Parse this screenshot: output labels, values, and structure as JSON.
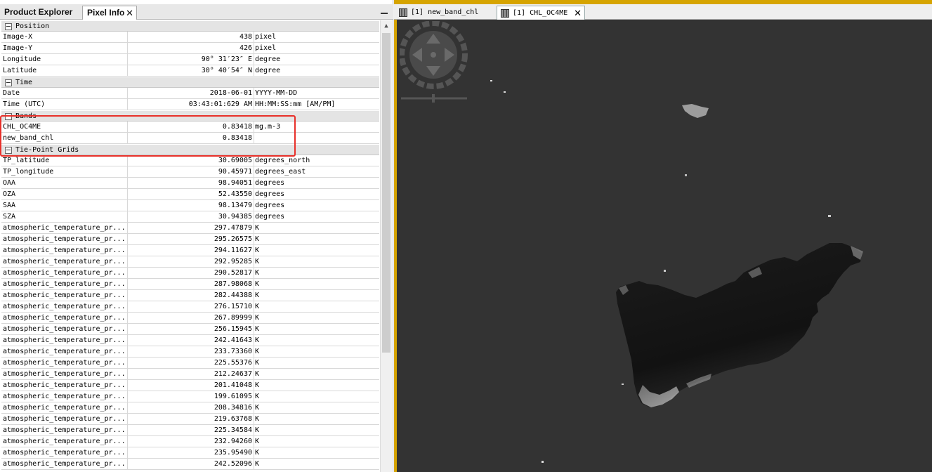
{
  "left_tabs": {
    "product_explorer": "Product Explorer",
    "pixel_info": "Pixel Info",
    "close_glyph": "✕"
  },
  "sections": [
    {
      "title": "Position",
      "rows": [
        [
          "Image-X",
          "438",
          "pixel"
        ],
        [
          "Image-Y",
          "426",
          "pixel"
        ],
        [
          "Longitude",
          "90° 31′23″ E",
          "degree"
        ],
        [
          "Latitude",
          "30° 40′54″ N",
          "degree"
        ]
      ]
    },
    {
      "title": "Time",
      "rows": [
        [
          "Date",
          "2018-06-01",
          "YYYY-MM-DD"
        ],
        [
          "Time (UTC)",
          "03:43:01:629 AM",
          "HH:MM:SS:mm [AM/PM]"
        ]
      ]
    },
    {
      "title": "Bands",
      "rows": [
        [
          "CHL_OC4ME",
          "0.83418",
          "mg.m-3"
        ],
        [
          "new_band_chl",
          "0.83418",
          ""
        ]
      ]
    },
    {
      "title": "Tie-Point Grids",
      "rows": [
        [
          "TP_latitude",
          "30.69005",
          "degrees_north"
        ],
        [
          "TP_longitude",
          "90.45971",
          "degrees_east"
        ],
        [
          "OAA",
          "98.94051",
          "degrees"
        ],
        [
          "OZA",
          "52.43550",
          "degrees"
        ],
        [
          "SAA",
          "98.13479",
          "degrees"
        ],
        [
          "SZA",
          "30.94385",
          "degrees"
        ],
        [
          "atmospheric_temperature_pr...",
          "297.47879",
          "K"
        ],
        [
          "atmospheric_temperature_pr...",
          "295.26575",
          "K"
        ],
        [
          "atmospheric_temperature_pr...",
          "294.11627",
          "K"
        ],
        [
          "atmospheric_temperature_pr...",
          "292.95285",
          "K"
        ],
        [
          "atmospheric_temperature_pr...",
          "290.52817",
          "K"
        ],
        [
          "atmospheric_temperature_pr...",
          "287.98068",
          "K"
        ],
        [
          "atmospheric_temperature_pr...",
          "282.44388",
          "K"
        ],
        [
          "atmospheric_temperature_pr...",
          "276.15710",
          "K"
        ],
        [
          "atmospheric_temperature_pr...",
          "267.89999",
          "K"
        ],
        [
          "atmospheric_temperature_pr...",
          "256.15945",
          "K"
        ],
        [
          "atmospheric_temperature_pr...",
          "242.41643",
          "K"
        ],
        [
          "atmospheric_temperature_pr...",
          "233.73360",
          "K"
        ],
        [
          "atmospheric_temperature_pr...",
          "225.55376",
          "K"
        ],
        [
          "atmospheric_temperature_pr...",
          "212.24637",
          "K"
        ],
        [
          "atmospheric_temperature_pr...",
          "201.41048",
          "K"
        ],
        [
          "atmospheric_temperature_pr...",
          "199.61095",
          "K"
        ],
        [
          "atmospheric_temperature_pr...",
          "208.34816",
          "K"
        ],
        [
          "atmospheric_temperature_pr...",
          "219.63768",
          "K"
        ],
        [
          "atmospheric_temperature_pr...",
          "225.34584",
          "K"
        ],
        [
          "atmospheric_temperature_pr...",
          "232.94260",
          "K"
        ],
        [
          "atmospheric_temperature_pr...",
          "235.95490",
          "K"
        ],
        [
          "atmospheric_temperature_pr...",
          "242.52096",
          "K"
        ]
      ]
    }
  ],
  "right_tabs": {
    "new_band": "[1] new_band_chl",
    "chl": "[1] CHL_OC4ME",
    "close_glyph": "✕"
  },
  "colors": {
    "highlight": "#e8302a",
    "view_background": "#333333",
    "panel_accent": "#d6a400"
  },
  "icons": [
    "close-icon",
    "minimize-icon",
    "collapse-icon",
    "band-image-icon",
    "navigation-control-icon",
    "scroll-up-icon"
  ]
}
